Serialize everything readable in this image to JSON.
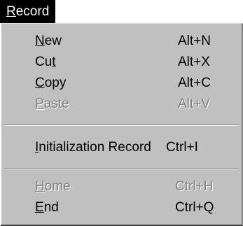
{
  "menu": {
    "title": "Record",
    "items": [
      {
        "label": "New",
        "shortcut": "Alt+N",
        "enabled": true
      },
      {
        "label": "Cut",
        "shortcut": "Alt+X",
        "enabled": true
      },
      {
        "label": "Copy",
        "shortcut": "Alt+C",
        "enabled": true
      },
      {
        "label": "Paste",
        "shortcut": "Alt+V",
        "enabled": false
      },
      {
        "label": "Initialization Record",
        "shortcut": "Ctrl+I",
        "enabled": true
      },
      {
        "label": "Home",
        "shortcut": "Ctrl+H",
        "enabled": false
      },
      {
        "label": "End",
        "shortcut": "Ctrl+Q",
        "enabled": true
      }
    ]
  },
  "colors": {
    "menu_background": "#c0c0c0",
    "title_background": "#000000",
    "title_text": "#ffffff",
    "enabled_text": "#000000",
    "disabled_text": "#808080"
  }
}
